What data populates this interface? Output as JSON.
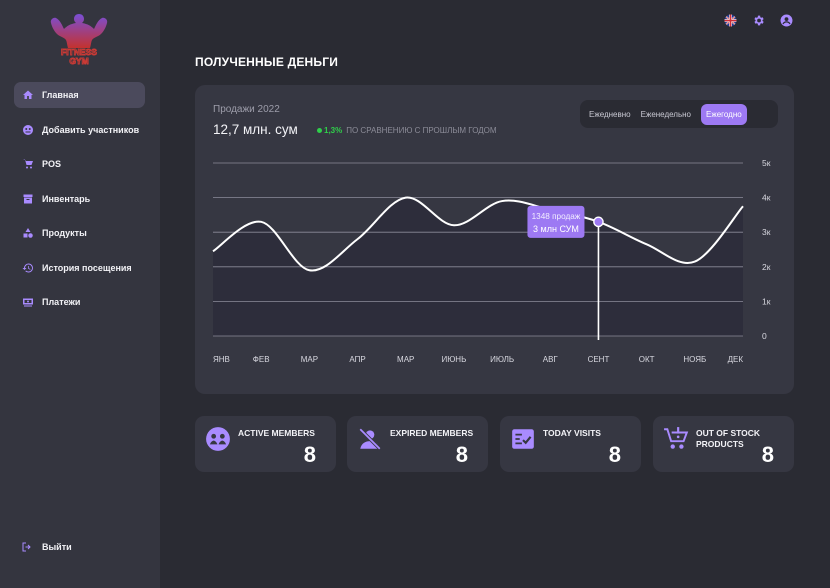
{
  "brand": {
    "logo_text_1": "FITNESS",
    "logo_text_2": "GYM"
  },
  "sidebar": {
    "items": [
      {
        "label": "Главная",
        "icon": "home-icon",
        "active": true
      },
      {
        "label": "Добавить участников",
        "icon": "add-members-icon",
        "active": false
      },
      {
        "label": "POS",
        "icon": "cart-icon",
        "active": false
      },
      {
        "label": "Инвентарь",
        "icon": "archive-icon",
        "active": false
      },
      {
        "label": "Продукты",
        "icon": "shapes-icon",
        "active": false
      },
      {
        "label": "История посещения",
        "icon": "history-icon",
        "active": false
      },
      {
        "label": "Платежи",
        "icon": "payments-icon",
        "active": false
      }
    ],
    "logout_label": "Выйти"
  },
  "header": {
    "icons": [
      "uk-flag-icon",
      "gear-icon",
      "user-icon"
    ]
  },
  "page": {
    "title": "ПОЛУЧЕННЫЕ ДЕНЬГИ"
  },
  "sales": {
    "label": "Продажи 2022",
    "total": "12,7 млн. сум",
    "change_pct": "1,3%",
    "change_text": "ПО СРАВНЕНИЮ С ПРОШЛЫМ ГОДОМ",
    "periods": [
      "Ежедневно",
      "Еженедельно",
      "Ежегодно"
    ],
    "active_period": "Ежегодно"
  },
  "chart_data": {
    "type": "line",
    "categories": [
      "ЯНВ",
      "ФЕВ",
      "МАР",
      "АПР",
      "МАР",
      "ИЮНЬ",
      "ИЮЛЬ",
      "АВГ",
      "СЕНТ",
      "ОКТ",
      "НОЯБ",
      "ДЕК"
    ],
    "values": [
      2.45,
      3.3,
      1.9,
      2.8,
      4.0,
      3.2,
      3.9,
      3.65,
      3.3,
      2.65,
      2.15,
      3.75
    ],
    "y_ticks": [
      "0",
      "1к",
      "2к",
      "3к",
      "4к",
      "5к"
    ],
    "ylim": [
      0,
      5
    ],
    "grid": true,
    "tooltip": {
      "category_index": 8,
      "line1": "1348 продаж",
      "line2": "3 млн СУМ"
    },
    "colors": {
      "line": "#ffffff",
      "fill": "#2d2d3b",
      "accent": "#9d79f3"
    }
  },
  "stats": [
    {
      "label_1": "ACTIVE MEMBERS",
      "label_2": "",
      "value": "8",
      "icon": "active-members-icon"
    },
    {
      "label_1": "EXPIRED MEMBERS",
      "label_2": "",
      "value": "8",
      "icon": "expired-members-icon"
    },
    {
      "label_1": "TODAY VISITS",
      "label_2": "",
      "value": "8",
      "icon": "today-visits-icon"
    },
    {
      "label_1": "OUT OF STOCK",
      "label_2": "PRODUCTS",
      "value": "8",
      "icon": "out-of-stock-icon"
    }
  ],
  "colors": {
    "accent": "#9d79f3",
    "background": "#2a2b33",
    "card": "#363742",
    "sidebar": "#34353f",
    "positive": "#2fcf4a"
  }
}
